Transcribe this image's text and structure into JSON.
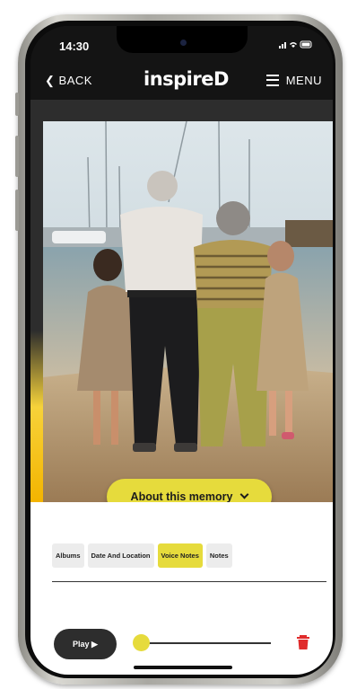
{
  "status": {
    "time": "14:30",
    "icons": "••• ◉ ▭"
  },
  "nav": {
    "back_label": "BACK",
    "logo": "inspireD",
    "menu_label": "MENU"
  },
  "memory": {
    "about_label": "About this memory"
  },
  "tabs": [
    {
      "label": "Albums",
      "active": false
    },
    {
      "label": "Date And Location",
      "active": false
    },
    {
      "label": "Voice Notes",
      "active": true
    },
    {
      "label": "Notes",
      "active": false
    }
  ],
  "player": {
    "play_label": "Play ▶",
    "progress": 0.0
  },
  "colors": {
    "accent": "#e6db3c",
    "dark": "#2d2d2d",
    "delete": "#e02b2b"
  }
}
